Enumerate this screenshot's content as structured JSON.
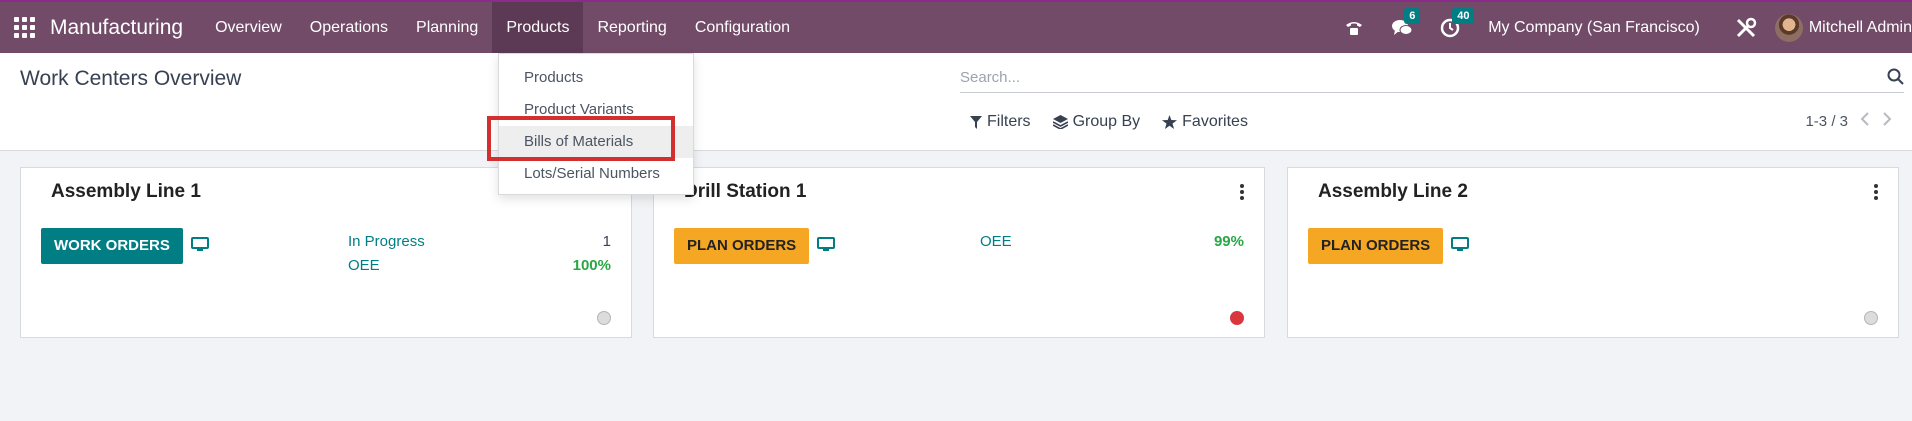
{
  "app": {
    "name": "Manufacturing",
    "menu": [
      "Overview",
      "Operations",
      "Planning",
      "Products",
      "Reporting",
      "Configuration"
    ],
    "active_menu": "Products"
  },
  "navbar": {
    "messages_count": "6",
    "activities_count": "40",
    "company": "My Company (San Francisco)",
    "user": "Mitchell Admin"
  },
  "page": {
    "title": "Work Centers Overview",
    "search_placeholder": "Search...",
    "filters_label": "Filters",
    "groupby_label": "Group By",
    "favorites_label": "Favorites",
    "pager": "1-3 / 3"
  },
  "products_dropdown": {
    "items": [
      "Products",
      "Product Variants",
      "Bills of Materials",
      "Lots/Serial Numbers"
    ],
    "highlighted": "Bills of Materials"
  },
  "cards": [
    {
      "title": "Assembly Line 1",
      "button": "WORK ORDERS",
      "stat1_label": "In Progress",
      "stat1_value": "1",
      "stat2_label": "OEE",
      "stat2_value": "100%",
      "status": "grey"
    },
    {
      "title": "Drill Station 1",
      "button": "PLAN ORDERS",
      "stat1_label": "OEE",
      "stat1_value": "99%",
      "status": "red"
    },
    {
      "title": "Assembly Line 2",
      "button": "PLAN ORDERS",
      "status": "grey"
    }
  ],
  "colors": {
    "navbar": "#714b67",
    "teal": "#017e84",
    "amber": "#f5a623",
    "status_red": "#d9363e",
    "status_grey": "#dcdcdc",
    "highlight_border": "#d32f2f"
  }
}
